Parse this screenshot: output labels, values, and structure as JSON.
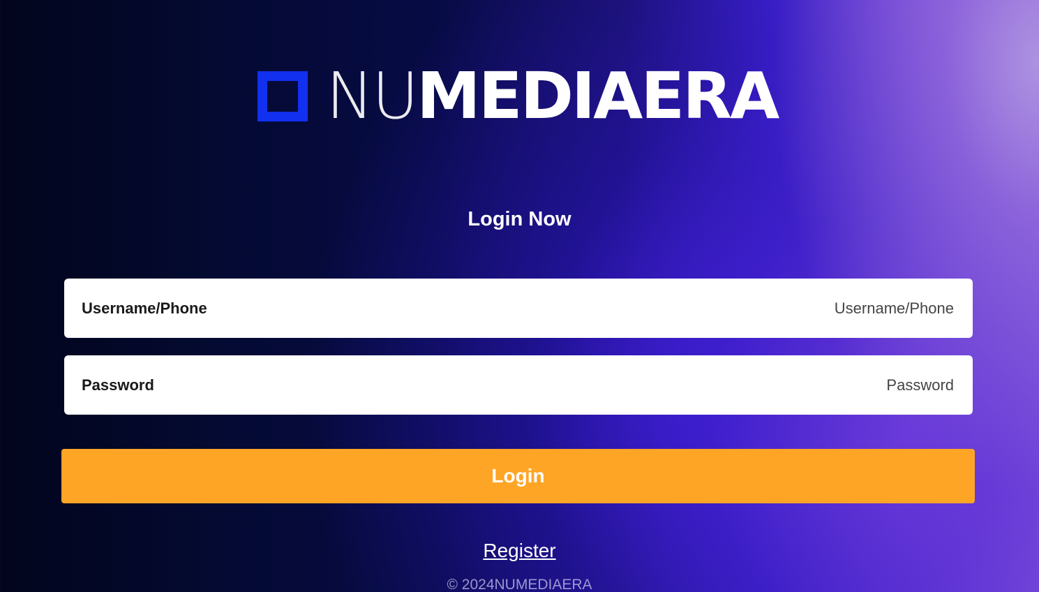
{
  "logo": {
    "part_thin": "NU",
    "part_mid": "MEDIA",
    "part_bold": "ERA",
    "icon": "square-outline-icon",
    "accent_color": "#1230f0"
  },
  "title": "Login Now",
  "form": {
    "username": {
      "label": "Username/Phone",
      "placeholder": "Username/Phone",
      "value": ""
    },
    "password": {
      "label": "Password",
      "placeholder": "Password",
      "value": ""
    },
    "login_label": "Login",
    "login_color": "#ffa526"
  },
  "register_label": "Register",
  "copyright": "© 2024NUMEDIAERA"
}
